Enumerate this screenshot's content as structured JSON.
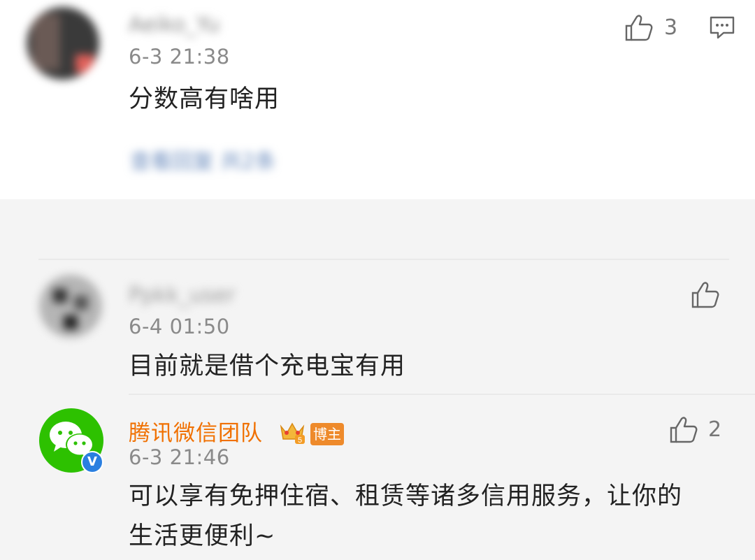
{
  "comment1": {
    "username": "Aeiko_Yu",
    "time": "6-3 21:38",
    "text": "分数高有啥用",
    "likes": "3",
    "sub_link": "查看回复 共2条"
  },
  "comment2": {
    "username": "Ppkk_user",
    "time": "6-4 01:50",
    "text": "目前就是借个充电宝有用"
  },
  "comment3": {
    "username": "腾讯微信团队",
    "badge": "博主",
    "time": "6-3 21:46",
    "text_line1": "可以享有免押住宿、租赁等诸多信用服务，让你的",
    "text_line2": "生活更便利~",
    "likes": "2"
  },
  "colors": {
    "wechat_green": "#2dc100",
    "orange_name": "#f07000",
    "verified_blue": "#2a7fe0"
  }
}
